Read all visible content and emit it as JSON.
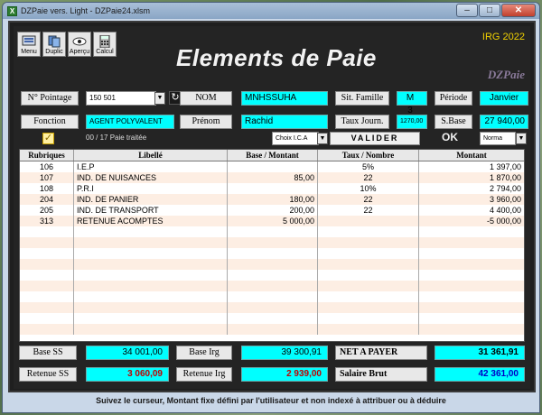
{
  "window": {
    "title": "DZPaie vers. Light - DZPaie24.xlsm",
    "app_icon": "X",
    "min_label": "–",
    "max_label": "□",
    "close_label": "✕"
  },
  "toolbar": {
    "menu": "Menu",
    "duplic": "Duplic",
    "apercu": "Aperçu",
    "calcul": "Calcul"
  },
  "header": {
    "title": "Elements de Paie",
    "irg": "IRG 2022",
    "brand": "DZPaie"
  },
  "form": {
    "pointage_label": "N° Pointage",
    "pointage_value": "150 501",
    "nom_label": "NOM",
    "nom_value": "MNHSSUHA",
    "sit_famille_label": "Sit. Famille",
    "sit_famille_value": "M",
    "sit_famille_count": "3",
    "periode_label": "Période",
    "periode_value": "Janvier",
    "fonction_label": "Fonction",
    "fonction_value": "AGENT POLYVALENT",
    "prenom_label": "Prénom",
    "prenom_value": "Rachid",
    "taux_journ_label": "Taux Journ.",
    "taux_journ_value": "1270,00",
    "sbase_label": "S.Base",
    "sbase_value": "27 940,00",
    "paie_count": "00 / 17  Paie traitée",
    "choix_ica": "Choix I.C.A",
    "valider": "VALIDER",
    "ok": "OK",
    "mode": "Norma"
  },
  "table": {
    "headers": [
      "Rubriques",
      "Libellé",
      "Base / Montant",
      "Taux / Nombre",
      "Montant"
    ],
    "rows": [
      {
        "code": "106",
        "libelle": "I.E.P",
        "base": "",
        "taux": "5%",
        "montant": "1 397,00"
      },
      {
        "code": "107",
        "libelle": "IND. DE NUISANCES",
        "base": "85,00",
        "taux": "22",
        "montant": "1 870,00"
      },
      {
        "code": "108",
        "libelle": "P.R.I",
        "base": "",
        "taux": "10%",
        "montant": "2 794,00"
      },
      {
        "code": "204",
        "libelle": "IND. DE PANIER",
        "base": "180,00",
        "taux": "22",
        "montant": "3 960,00"
      },
      {
        "code": "205",
        "libelle": "IND. DE TRANSPORT",
        "base": "200,00",
        "taux": "22",
        "montant": "4 400,00"
      },
      {
        "code": "313",
        "libelle": "RETENUE ACOMPTES",
        "base": "5 000,00",
        "taux": "",
        "montant": "-5 000,00"
      }
    ],
    "empty_rows": 10
  },
  "totals": {
    "base_ss_label": "Base SS",
    "base_ss_value": "34 001,00",
    "base_irg_label": "Base Irg",
    "base_irg_value": "39 300,91",
    "net_label": "NET A PAYER",
    "net_value": "31 361,91",
    "ret_ss_label": "Retenue SS",
    "ret_ss_value": "3 060,09",
    "ret_irg_label": "Retenue Irg",
    "ret_irg_value": "2 939,00",
    "brut_label": "Salaire Brut",
    "brut_value": "42 361,00"
  },
  "status": "Suivez le curseur, Montant fixe défini par l'utilisateur et non indexé à attribuer ou à déduire",
  "colors": {
    "cyan": "#00ffff",
    "net_red": "#c00000",
    "brut_blue": "#0000c8",
    "irg_yellow": "#f0d000"
  }
}
